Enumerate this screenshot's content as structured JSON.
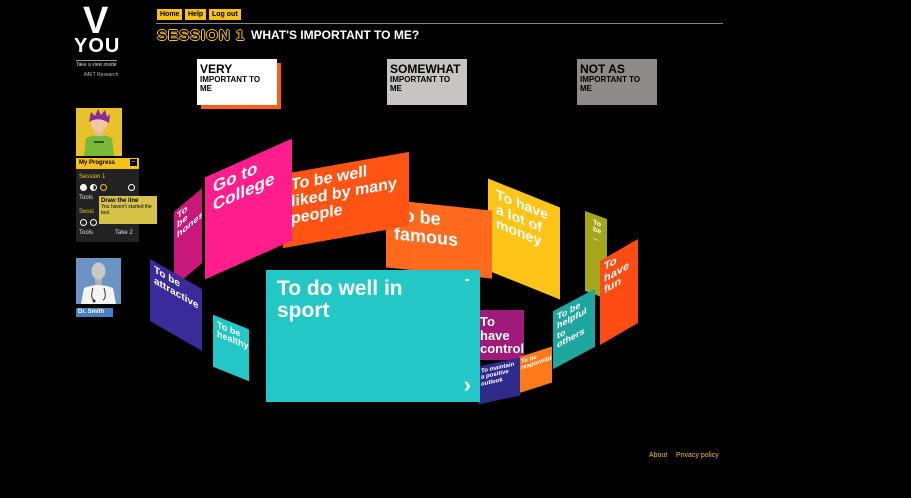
{
  "brand": {
    "v": "V",
    "you": "YOU",
    "tagline": "Take a view inside",
    "org": "iMET Research"
  },
  "nav": {
    "home": "Home",
    "help": "Help",
    "logout": "Log out"
  },
  "header": {
    "session": "SESSION 1",
    "title": "WHAT'S IMPORTANT TO ME?"
  },
  "categories": {
    "very": {
      "big": "VERY",
      "small": "IMPORTANT TO ME"
    },
    "somewhat": {
      "big": "SOMEWHAT",
      "small": "IMPORTANT TO ME"
    },
    "notas": {
      "big": "NOT AS",
      "small": "IMPORTANT TO ME"
    }
  },
  "progress": {
    "title": "My Progress",
    "minus": "–",
    "session1": "Session 1",
    "session2": "Sessi",
    "tools": "Tools",
    "tools2": "Tools",
    "take2": "Take 2"
  },
  "tooltip": {
    "title": "Draw the line",
    "text": "You haven't started the tool."
  },
  "doctor": {
    "name": "Dr. Smith"
  },
  "cards": {
    "college": "Go to College",
    "liked": "To be well liked by many people",
    "famous": "To be famous",
    "money": "To have a lot of money",
    "honest": "To be honest",
    "attractive": "To be attractive",
    "healthy": "To be healthy",
    "sport": "To do well in sport",
    "sport_minus": "-",
    "sport_arrow": "›",
    "control": "To have control",
    "outlook": "To maintain a positive outlook",
    "responsible": "To be responsible",
    "helpful": "To be helpful to others",
    "fun": "To have fun",
    "yellow_small": "To be ..."
  },
  "footer": {
    "about": "About",
    "privacy": "Privacy policy"
  }
}
